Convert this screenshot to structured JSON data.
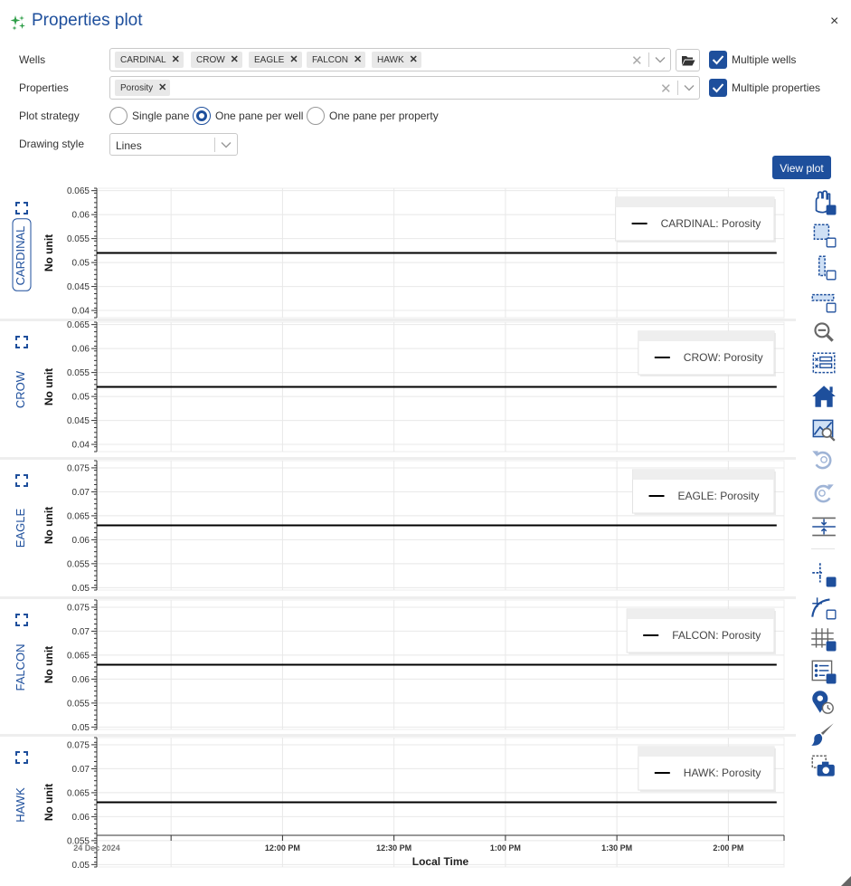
{
  "window": {
    "title": "Properties plot",
    "close_label": "×"
  },
  "form": {
    "wells_label": "Wells",
    "wells": [
      "CARDINAL",
      "CROW",
      "EAGLE",
      "FALCON",
      "HAWK"
    ],
    "multiple_wells_label": "Multiple wells",
    "multiple_wells_checked": true,
    "properties_label": "Properties",
    "properties": [
      "Porosity"
    ],
    "multiple_properties_label": "Multiple properties",
    "multiple_properties_checked": true,
    "plot_strategy_label": "Plot strategy",
    "plot_strategy_options": [
      "Single pane",
      "One pane per well",
      "One pane per property"
    ],
    "plot_strategy_selected": "One pane per well",
    "drawing_style_label": "Drawing style",
    "drawing_style_value": "Lines",
    "view_plot_label": "View plot",
    "tag_remove_glyph": "✕",
    "clear_glyph": "✕"
  },
  "chart_data": {
    "type": "line",
    "xlabel": "Local Time",
    "x_ticks": [
      "12:00 PM",
      "12:30 PM",
      "1:00 PM",
      "1:30 PM",
      "2:00 PM"
    ],
    "x_date_label": "24 Dec 2024",
    "x_range": [
      "2024-12-24 11:10",
      "2024-12-24 14:15"
    ],
    "panes": [
      {
        "well": "CARDINAL",
        "ylabel": "No unit",
        "ylim": [
          0.0385,
          0.0655
        ],
        "yticks": [
          "0.065",
          "0.06",
          "0.055",
          "0.05",
          "0.045",
          "0.04"
        ],
        "series": [
          {
            "name": "CARDINAL: Porosity",
            "x": [
              "2024-12-24 11:10",
              "2024-12-24 14:13"
            ],
            "y": [
              0.052,
              0.052
            ]
          }
        ],
        "active": true
      },
      {
        "well": "CROW",
        "ylabel": "No unit",
        "ylim": [
          0.0385,
          0.0655
        ],
        "yticks": [
          "0.065",
          "0.06",
          "0.055",
          "0.05",
          "0.045",
          "0.04"
        ],
        "series": [
          {
            "name": "CROW: Porosity",
            "x": [
              "2024-12-24 11:10",
              "2024-12-24 14:13"
            ],
            "y": [
              0.052,
              0.052
            ]
          }
        ]
      },
      {
        "well": "EAGLE",
        "ylabel": "No unit",
        "ylim": [
          0.0495,
          0.0765
        ],
        "yticks": [
          "0.075",
          "0.07",
          "0.065",
          "0.06",
          "0.055",
          "0.05"
        ],
        "series": [
          {
            "name": "EAGLE: Porosity",
            "x": [
              "2024-12-24 11:10",
              "2024-12-24 14:13"
            ],
            "y": [
              0.063,
              0.063
            ]
          }
        ]
      },
      {
        "well": "FALCON",
        "ylabel": "No unit",
        "ylim": [
          0.0495,
          0.0765
        ],
        "yticks": [
          "0.075",
          "0.07",
          "0.065",
          "0.06",
          "0.055",
          "0.05"
        ],
        "series": [
          {
            "name": "FALCON: Porosity",
            "x": [
              "2024-12-24 11:10",
              "2024-12-24 14:13"
            ],
            "y": [
              0.063,
              0.063
            ]
          }
        ]
      },
      {
        "well": "HAWK",
        "ylabel": "No unit",
        "ylim": [
          0.0495,
          0.0765
        ],
        "yticks": [
          "0.075",
          "0.07",
          "0.065",
          "0.06",
          "0.055",
          "0.05"
        ],
        "series": [
          {
            "name": "HAWK: Porosity",
            "x": [
              "2024-12-24 11:10",
              "2024-12-24 14:13"
            ],
            "y": [
              0.063,
              0.063
            ]
          }
        ]
      }
    ],
    "grid": true,
    "legend_position": "top-right"
  },
  "toolbar": {
    "tools": [
      "pan-icon",
      "box-zoom-icon",
      "x-zoom-icon",
      "y-zoom-icon",
      "zoom-out-icon",
      "box-select-icon",
      "reset-home-icon",
      "zoom-to-fit-icon",
      "undo-icon",
      "redo-icon",
      "range-tool-icon",
      "crosshair-icon",
      "hover-curve-icon",
      "grid-toggle-icon",
      "legend-toggle-icon",
      "point-draw-icon",
      "freehand-draw-icon",
      "save-snapshot-icon"
    ]
  },
  "colors": {
    "accent": "#1e4f9c",
    "line": "#000000",
    "grid": "#e8e8e8"
  }
}
